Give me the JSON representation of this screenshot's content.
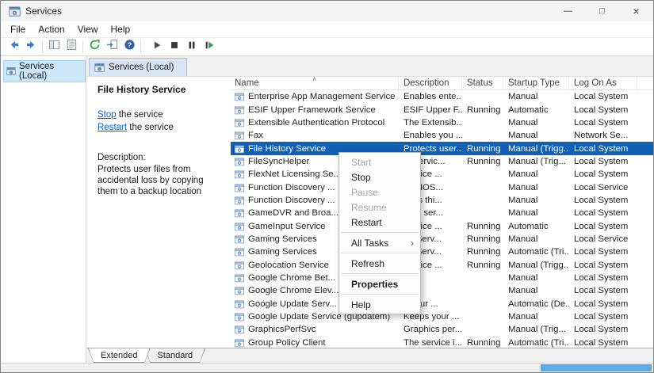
{
  "window": {
    "title": "Services"
  },
  "icons": {
    "minimize": "—",
    "maximize": "□",
    "close": "×",
    "sort_ascending": "∧",
    "submenu_arrow": "›"
  },
  "colors": {
    "selection": "#1060b6",
    "link": "#0066cc",
    "scroll_thumb": "#64a9e0"
  },
  "menubar": {
    "items": [
      "File",
      "Action",
      "View",
      "Help"
    ]
  },
  "console_tree": {
    "root_label": "Services (Local)"
  },
  "result_pane": {
    "tab_label": "Services (Local)"
  },
  "task_pane": {
    "title": "File History Service",
    "actions": [
      {
        "link": "Stop",
        "suffix": " the service"
      },
      {
        "link": "Restart",
        "suffix": " the service"
      }
    ],
    "description_label": "Description:",
    "description_text": "Protects user files from accidental loss by copying them to a backup location"
  },
  "services_table": {
    "columns": [
      {
        "label": "Name",
        "sorted": true
      },
      {
        "label": "Description"
      },
      {
        "label": "Status"
      },
      {
        "label": "Startup Type"
      },
      {
        "label": "Log On As"
      }
    ],
    "rows": [
      {
        "name": "Enterprise App Management Service",
        "description": "Enables ente...",
        "status": "",
        "startup_type": "Manual",
        "log_on_as": "Local System",
        "selected": false
      },
      {
        "name": "ESIF Upper Framework Service",
        "description": "ESIF Upper F...",
        "status": "Running",
        "startup_type": "Automatic",
        "log_on_as": "Local System",
        "selected": false
      },
      {
        "name": "Extensible Authentication Protocol",
        "description": "The Extensib...",
        "status": "",
        "startup_type": "Manual",
        "log_on_as": "Local System",
        "selected": false
      },
      {
        "name": "Fax",
        "description": "Enables you ...",
        "status": "",
        "startup_type": "Manual",
        "log_on_as": "Network Se...",
        "selected": false
      },
      {
        "name": "File History Service",
        "description": "Protects user...",
        "status": "Running",
        "startup_type": "Manual (Trigg...",
        "log_on_as": "Local System",
        "selected": true
      },
      {
        "name": "FileSyncHelper",
        "description": "er servic...",
        "status": "Running",
        "startup_type": "Manual (Trig...",
        "log_on_as": "Local System",
        "selected": false
      },
      {
        "name": "FlexNet Licensing Se...",
        "description": "service ...",
        "status": "",
        "startup_type": "Manual",
        "log_on_as": "Local System",
        "selected": false
      },
      {
        "name": "Function Discovery ...",
        "description": "DPHOS...",
        "status": "",
        "startup_type": "Manual",
        "log_on_as": "Local Service",
        "selected": false
      },
      {
        "name": "Function Discovery ...",
        "description": "shes thi...",
        "status": "",
        "startup_type": "Manual",
        "log_on_as": "Local System",
        "selected": false
      },
      {
        "name": "GameDVR and Broa...",
        "description": "user ser...",
        "status": "",
        "startup_type": "Manual",
        "log_on_as": "Local System",
        "selected": false
      },
      {
        "name": "GameInput Service",
        "description": "service ...",
        "status": "Running",
        "startup_type": "Automatic",
        "log_on_as": "Local System",
        "selected": false
      },
      {
        "name": "Gaming Services",
        "description": "ng Serv...",
        "status": "Running",
        "startup_type": "Manual",
        "log_on_as": "Local Service",
        "selected": false
      },
      {
        "name": "Gaming Services",
        "description": "ng Serv...",
        "status": "Running",
        "startup_type": "Automatic (Tri...",
        "log_on_as": "Local System",
        "selected": false
      },
      {
        "name": "Geolocation Service",
        "description": "service ...",
        "status": "Running",
        "startup_type": "Manual (Trigg...",
        "log_on_as": "Local System",
        "selected": false
      },
      {
        "name": "Google Chrome Bet...",
        "description": "",
        "status": "",
        "startup_type": "Manual",
        "log_on_as": "Local System",
        "selected": false
      },
      {
        "name": "Google Chrome Elev...",
        "description": "",
        "status": "",
        "startup_type": "Manual",
        "log_on_as": "Local System",
        "selected": false
      },
      {
        "name": "Google Update Serv...",
        "description": "s your ...",
        "status": "",
        "startup_type": "Automatic (De...",
        "log_on_as": "Local System",
        "selected": false
      },
      {
        "name": "Google Update Service (gupdatem)",
        "description": "Keeps your ...",
        "status": "",
        "startup_type": "Manual",
        "log_on_as": "Local System",
        "selected": false
      },
      {
        "name": "GraphicsPerfSvc",
        "description": "Graphics per...",
        "status": "",
        "startup_type": "Manual (Trig...",
        "log_on_as": "Local System",
        "selected": false
      },
      {
        "name": "Group Policy Client",
        "description": "The service i...",
        "status": "Running",
        "startup_type": "Automatic (Tri...",
        "log_on_as": "Local System",
        "selected": false
      }
    ]
  },
  "context_menu": {
    "items": [
      {
        "label": "Start",
        "disabled": true
      },
      {
        "label": "Stop"
      },
      {
        "label": "Pause",
        "disabled": true
      },
      {
        "label": "Resume",
        "disabled": true
      },
      {
        "label": "Restart"
      },
      {
        "separator": true
      },
      {
        "label": "All Tasks",
        "submenu": true
      },
      {
        "separator": true
      },
      {
        "label": "Refresh"
      },
      {
        "separator": true
      },
      {
        "label": "Properties",
        "bold": true
      },
      {
        "separator": true
      },
      {
        "label": "Help"
      }
    ]
  },
  "view_tabs": {
    "items": [
      {
        "label": "Extended",
        "active": true
      },
      {
        "label": "Standard",
        "active": false
      }
    ]
  }
}
